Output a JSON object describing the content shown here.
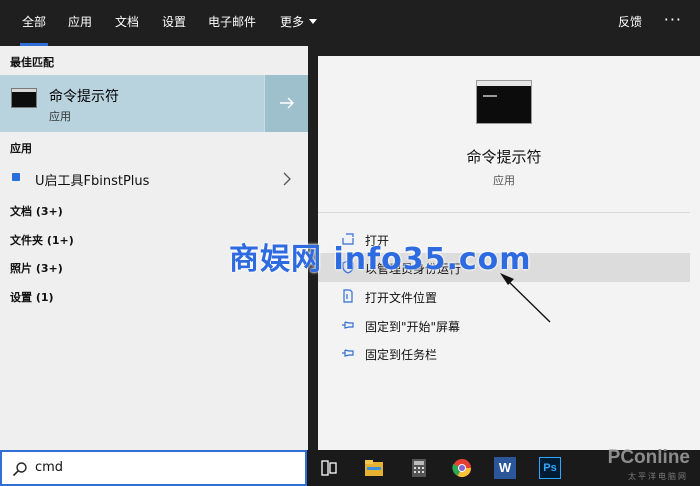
{
  "tabs": [
    {
      "label": "全部",
      "active": true
    },
    {
      "label": "应用"
    },
    {
      "label": "文档"
    },
    {
      "label": "设置"
    },
    {
      "label": "电子邮件"
    },
    {
      "label": "更多"
    }
  ],
  "header": {
    "feedback_label": "反馈",
    "more_options": "···"
  },
  "left": {
    "best_match_heading": "最佳匹配",
    "best_match": {
      "title": "命令提示符",
      "subtitle": "应用"
    },
    "apps_heading": "应用",
    "app_item": {
      "label": "U启工具FbinstPlus"
    },
    "categories": [
      "文档 (3+)",
      "文件夹 (1+)",
      "照片 (3+)",
      "设置 (1)"
    ]
  },
  "detail": {
    "title": "命令提示符",
    "subtitle": "应用",
    "actions": [
      {
        "label": "打开",
        "icon": "open-icon"
      },
      {
        "label": "以管理员身份运行",
        "icon": "shield-icon"
      },
      {
        "label": "打开文件位置",
        "icon": "file-location-icon"
      },
      {
        "label": "固定到\"开始\"屏幕",
        "icon": "pin-icon"
      },
      {
        "label": "固定到任务栏",
        "icon": "pin-icon"
      }
    ]
  },
  "watermark": "商娱网 info35.com",
  "search": {
    "value": "cmd"
  },
  "taskbar": {
    "icons": [
      "task-view-icon",
      "file-explorer-icon",
      "calculator-icon",
      "chrome-icon",
      "word-icon",
      "photoshop-icon"
    ],
    "word_label": "W",
    "ps_label": "Ps"
  },
  "brand": {
    "name": "PConline",
    "sub": "太平洋电脑网"
  },
  "colors": {
    "accent": "#2f6fd6",
    "highlight": "#b9d3de",
    "topbar": "#1f1f1f"
  }
}
